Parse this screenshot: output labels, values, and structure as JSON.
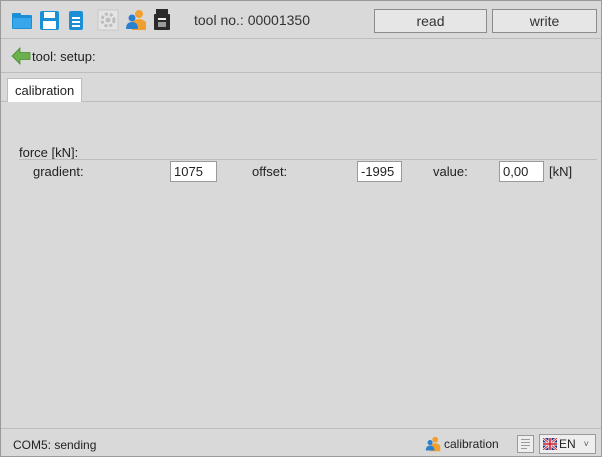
{
  "toolbar": {
    "icons": [
      "folder-open-icon",
      "save-icon",
      "print-icon",
      "gear-icon",
      "user-icon",
      "device-icon"
    ],
    "tool_label": "tool no.: 00001350",
    "read_label": "read",
    "write_label": "write"
  },
  "breadcrumb": {
    "text": "tool: setup:"
  },
  "tabs": [
    {
      "label": "calibration",
      "active": true
    }
  ],
  "section": {
    "title": "force [kN]:",
    "gradient_label": "gradient:",
    "gradient_value": "1075",
    "offset_label": "offset:",
    "offset_value": "-1995",
    "value_label": "value:",
    "value_value": "0,00",
    "unit": "[kN]"
  },
  "statusbar": {
    "connection_text": "COM5: sending",
    "mode_text": "calibration",
    "language": "EN"
  },
  "colors": {
    "background": "#d9d9d9",
    "folder_blue": "#1b8fd6",
    "back_green": "#6ab04c",
    "user_orange": "#f0a030",
    "user_blue": "#2b7fd0"
  }
}
